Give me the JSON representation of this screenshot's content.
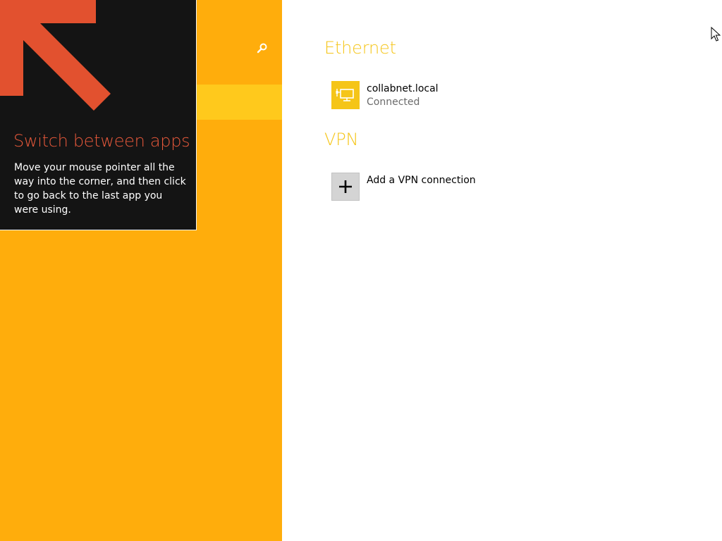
{
  "colors": {
    "nav_background": "#ffad0c",
    "nav_selected": "#ffc91c",
    "tip_background": "#141414",
    "tip_title": "#e9593b",
    "section_heading": "#f5c518",
    "ethernet_tile": "#f5c518"
  },
  "nav": {
    "search_icon": "search-icon",
    "selected_item_label": ""
  },
  "tip": {
    "title": "Switch between apps",
    "body": "Move your mouse pointer all the way into the corner, and then click to go back to the last app you were using.",
    "arrow_icon": "arrow-up-left-icon"
  },
  "content": {
    "ethernet": {
      "heading": "Ethernet",
      "connection": {
        "name": "collabnet.local",
        "status": "Connected",
        "icon": "ethernet-icon"
      }
    },
    "vpn": {
      "heading": "VPN",
      "add_label": "Add a VPN connection",
      "icon": "plus-icon"
    }
  }
}
